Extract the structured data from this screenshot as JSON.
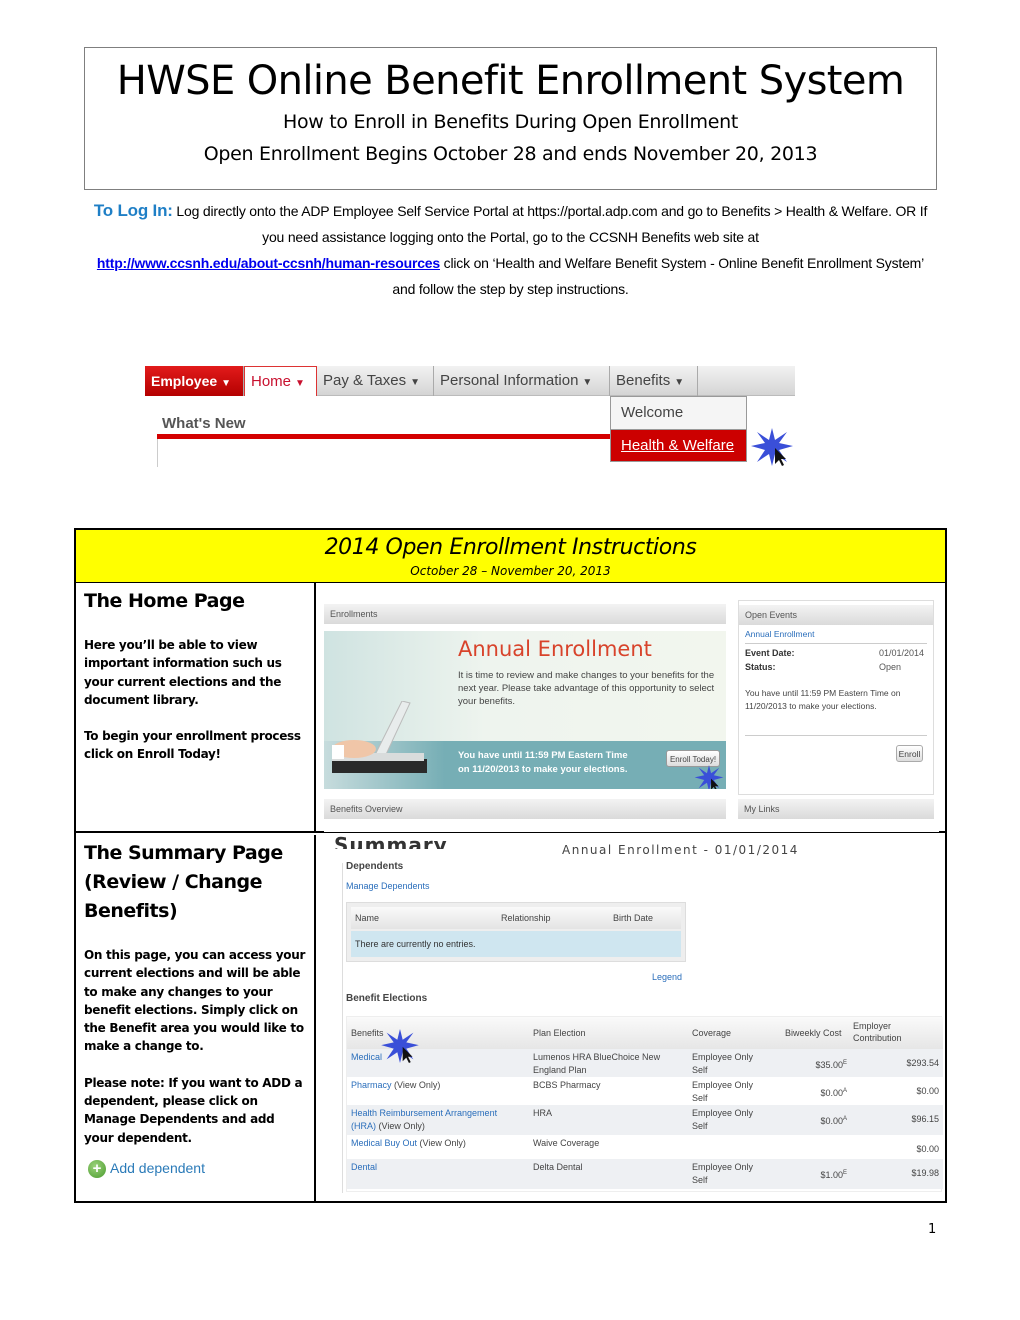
{
  "header": {
    "title": "HWSE Online Benefit Enrollment System",
    "subtitle": "How to Enroll in Benefits During Open Enrollment",
    "dates": "Open Enrollment Begins October 28 and ends November 20, 2013"
  },
  "login": {
    "label": "To Log In:",
    "text1": "Log directly onto the ADP Employee Self Service Portal at https://portal.adp.com and go to Benefits > Health & Welfare. OR If you need assistance logging onto the Portal, go to the CCSNH Benefits web site at",
    "link": "http://www.ccsnh.edu/about-ccsnh/human-resources",
    "text2": "click on ‘Health and Welfare Benefit System - Online Benefit Enrollment System’ and follow the step by step instructions."
  },
  "nav_screenshot": {
    "tabs": [
      {
        "label": "Employee"
      },
      {
        "label": "Home"
      },
      {
        "label": "Pay & Taxes"
      },
      {
        "label": "Personal Information"
      },
      {
        "label": "Benefits"
      }
    ],
    "caret": "▼",
    "section_title": "What's New",
    "dropdown": [
      {
        "label": "Welcome"
      },
      {
        "label": "Health & Welfare"
      }
    ]
  },
  "instructions": {
    "title": "2014 Open Enrollment Instructions",
    "dates": "October 28 – November 20, 2013",
    "home": {
      "title": "The Home Page",
      "para1": "Here you’ll be able to view important information such us your current elections and the document library.",
      "para2": "To begin your enrollment process click on Enroll Today!",
      "shot": {
        "enrollments_header": "Enrollments",
        "banner_title": "Annual Enrollment",
        "banner_text": "It is time to review and make changes to your benefits for the next year. Please take advantage of this opportunity to select your benefits.",
        "banner_deadline_1": "You have until 11:59 PM Eastern Time",
        "banner_deadline_2": "on 11/20/2013 to make your elections.",
        "enroll_today_button": "Enroll Today!",
        "benefits_overview_header": "Benefits Overview",
        "open_events_header": "Open Events",
        "open_events_link": "Annual Enrollment",
        "event_date_label": "Event Date:",
        "event_date_value": "01/01/2014",
        "status_label": "Status:",
        "status_value": "Open",
        "deadline_text": "You have until 11:59 PM Eastern Time on 11/20/2013 to make your elections.",
        "enroll_button": "Enroll",
        "my_links_header": "My Links"
      }
    },
    "summary": {
      "title_line1": "The Summary Page",
      "title_line2": "(Review / Change",
      "title_line3": "Benefits)",
      "para1": "On this page, you can access your current elections and will be able to make any changes to your benefit elections.  Simply click on the Benefit area you would like to make a change to.",
      "para2": "Please note:  If you want to ADD a dependent, please click on Manage Dependents and add your dependent.",
      "add_dependent": "Add dependent",
      "shot": {
        "title": "Summary",
        "subtitle": "Annual Enrollment - 01/01/2014",
        "dependents_header": "Dependents",
        "manage_dependents": "Manage Dependents",
        "dep_columns": [
          "Name",
          "Relationship",
          "Birth Date"
        ],
        "dep_empty": "There are currently no entries.",
        "legend": "Legend",
        "elections_header": "Benefit Elections",
        "columns": [
          "Benefits",
          "Plan Election",
          "Coverage",
          "Biweekly Cost",
          "Employer Contribution"
        ],
        "rows": [
          {
            "benefit": "Medical",
            "note": "",
            "plan": "Lumenos HRA BlueChoice New England Plan",
            "coverage": "Employee Only Self",
            "cost": "$35.00",
            "cost_mark": "E",
            "employer": "$293.54"
          },
          {
            "benefit": "Pharmacy",
            "note": "(View Only)",
            "plan": "BCBS Pharmacy",
            "coverage": "Employee Only Self",
            "cost": "$0.00",
            "cost_mark": "A",
            "employer": "$0.00"
          },
          {
            "benefit": "Health Reimbursement Arrangement (HRA)",
            "note": "(View Only)",
            "plan": "HRA",
            "coverage": "Employee Only Self",
            "cost": "$0.00",
            "cost_mark": "A",
            "employer": "$96.15"
          },
          {
            "benefit": "Medical Buy Out",
            "note": "(View Only)",
            "plan": "Waive Coverage",
            "coverage": "",
            "cost": "",
            "cost_mark": "",
            "employer": "$0.00"
          },
          {
            "benefit": "Dental",
            "note": "",
            "plan": "Delta Dental",
            "coverage": "Employee Only Self",
            "cost": "$1.00",
            "cost_mark": "E",
            "employer": "$19.98"
          }
        ]
      }
    }
  },
  "page_number": "1"
}
